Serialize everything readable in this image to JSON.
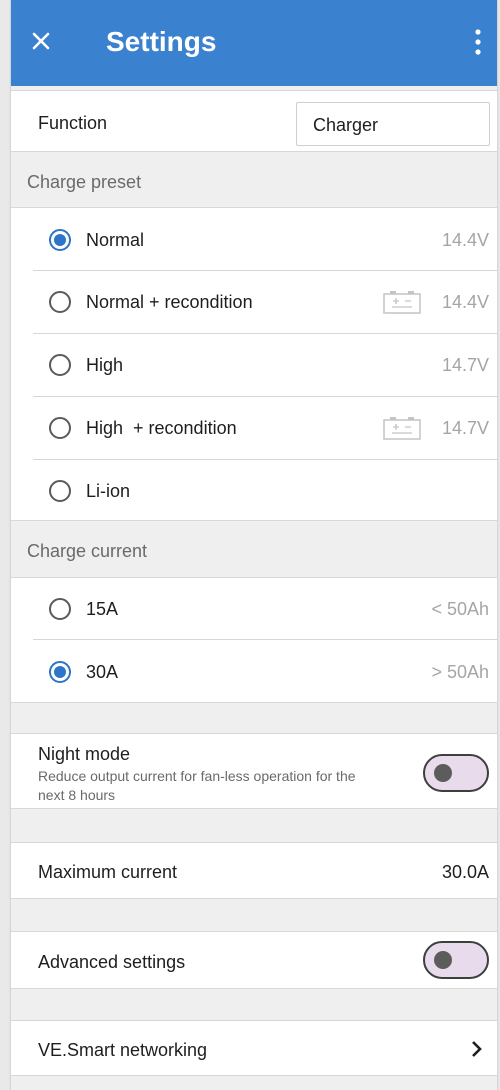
{
  "header": {
    "title": "Settings",
    "close_icon": "close-icon",
    "menu_icon": "more-vert-icon",
    "color": "#3a81d0"
  },
  "function": {
    "label": "Function",
    "value": "Charger"
  },
  "charge_preset": {
    "header": "Charge preset",
    "options": [
      {
        "label": "Normal",
        "voltage": "14.4V",
        "selected": true,
        "battery_icon": false
      },
      {
        "label": "Normal + recondition",
        "voltage": "14.4V",
        "selected": false,
        "battery_icon": true
      },
      {
        "label": "High",
        "voltage": "14.7V",
        "selected": false,
        "battery_icon": false
      },
      {
        "label": "High  + recondition",
        "voltage": "14.7V",
        "selected": false,
        "battery_icon": true
      },
      {
        "label": "Li-ion",
        "voltage": "",
        "selected": false,
        "battery_icon": false
      }
    ]
  },
  "charge_current": {
    "header": "Charge current",
    "options": [
      {
        "label": "15A",
        "capacity": "< 50Ah",
        "selected": false
      },
      {
        "label": "30A",
        "capacity": "> 50Ah",
        "selected": true
      }
    ]
  },
  "night_mode": {
    "label": "Night mode",
    "description_line1": "Reduce output current for fan-less operation for the",
    "description_line2": "next 8 hours",
    "enabled": false
  },
  "maximum_current": {
    "label": "Maximum current",
    "value": "30.0A"
  },
  "advanced_settings": {
    "label": "Advanced settings",
    "enabled": false
  },
  "smart_networking": {
    "label": "VE.Smart networking",
    "chevron_icon": "chevron-right-icon"
  },
  "accent_color": "#2e74c9"
}
